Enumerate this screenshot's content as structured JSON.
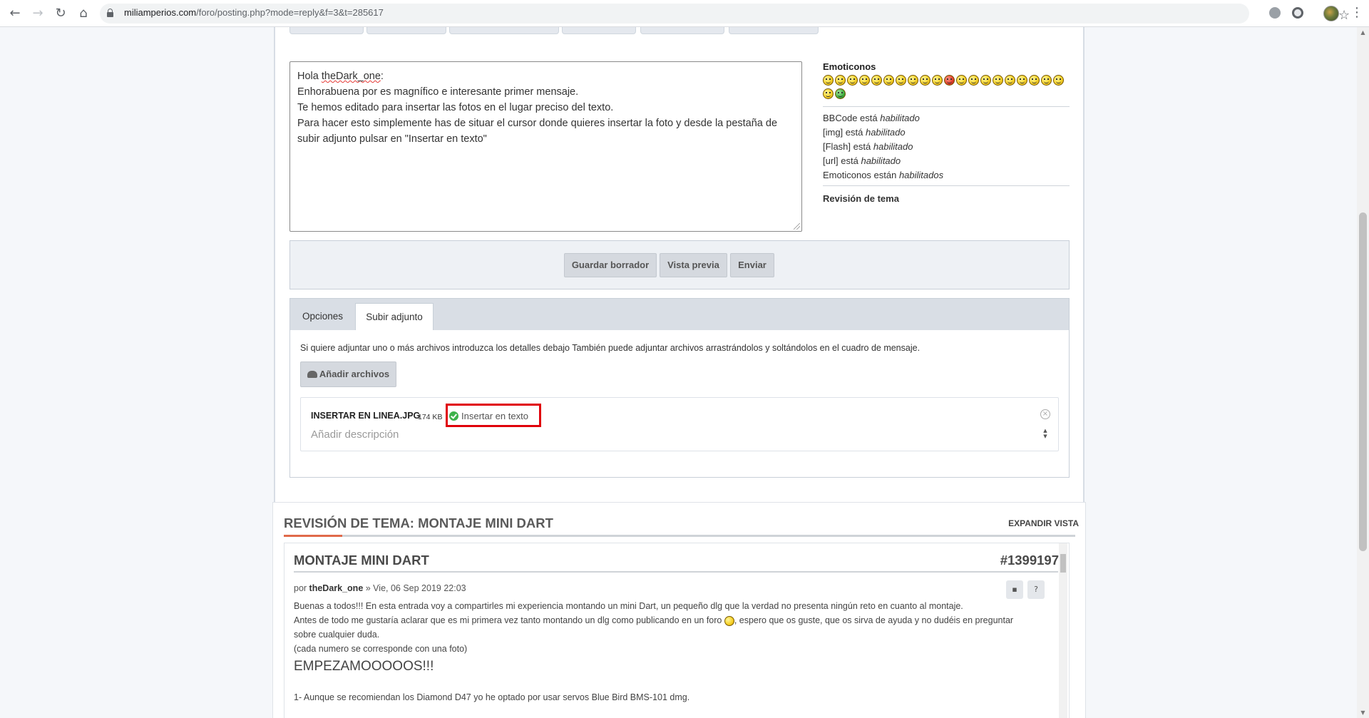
{
  "browser": {
    "url_host": "miliamperios.com",
    "url_path": "/foro/posting.php?mode=reply&f=3&t=285617",
    "back_icon": "←",
    "forward_icon": "→",
    "reload_icon": "↻",
    "home_icon": "⌂",
    "star_icon": "☆",
    "menu_icon": "⋮"
  },
  "editor": {
    "greeting_prefix": "Hola ",
    "greeting_name": "theDark_one",
    "greeting_suffix": ":",
    "lines": [
      "Enhorabuena por es magnífico e interesante primer mensaje.",
      "Te hemos editado para insertar las fotos en el lugar preciso del texto.",
      "Para hacer esto simplemente has de situar el cursor donde quieres insertar la foto y desde la pestaña de",
      "subir adjunto pulsar en \"Insertar en texto\""
    ]
  },
  "side": {
    "emoticons_title": "Emoticonos",
    "status": [
      {
        "label": "BBCode está ",
        "state": "habilitado"
      },
      {
        "label": "[img] está ",
        "state": "habilitado"
      },
      {
        "label": "[Flash] está ",
        "state": "habilitado"
      },
      {
        "label": "[url] está ",
        "state": "habilitado"
      },
      {
        "label": "Emoticonos están ",
        "state": "habilitados"
      }
    ],
    "topic_review_label": "Revisión de tema"
  },
  "submit": {
    "save_draft": "Guardar borrador",
    "preview": "Vista previa",
    "send": "Enviar"
  },
  "tabs": {
    "options": "Opciones",
    "upload": "Subir adjunto"
  },
  "attachments": {
    "help": "Si quiere adjuntar uno o más archivos introduzca los detalles debajo También puede adjuntar archivos arrastrándolos y soltándolos en el cuadro de mensaje.",
    "add_files": "Añadir archivos",
    "file_name": "INSERTAR EN LINEA.JPG",
    "file_size": "174 KB",
    "insert_inline": "Insertar en texto",
    "description_placeholder": "Añadir descripción"
  },
  "review": {
    "header": "REVISIÓN DE TEMA: MONTAJE MINI DART",
    "expand": "EXPANDIR VISTA",
    "post_title": "MONTAJE MINI DART",
    "post_id": "#1399197",
    "meta_prefix": "por ",
    "meta_author": "theDark_one",
    "meta_date": " » Vie, 06 Sep 2019 22:03",
    "body_line1": "Buenas a todos!!! En esta entrada voy a compartirles mi experiencia montando un mini Dart, un pequeño dlg que la verdad no presenta ningún reto en cuanto al montaje.",
    "body_line2a": "Antes de todo me gustaría aclarar que es mi primera vez tanto montando un dlg como publicando en un foro ",
    "body_line2b": ", espero que os guste, que os sirva de ayuda y no dudéis en preguntar",
    "body_line3": "sobre cualquier duda.",
    "body_line4": "(cada numero se corresponde con una foto)",
    "body_big": "EMPEZAMOOOOOS!!!",
    "body_line5": "1- Aunque se recomiendan los Diamond D47 yo he optado por usar servos Blue Bird BMS-101 dmg."
  }
}
